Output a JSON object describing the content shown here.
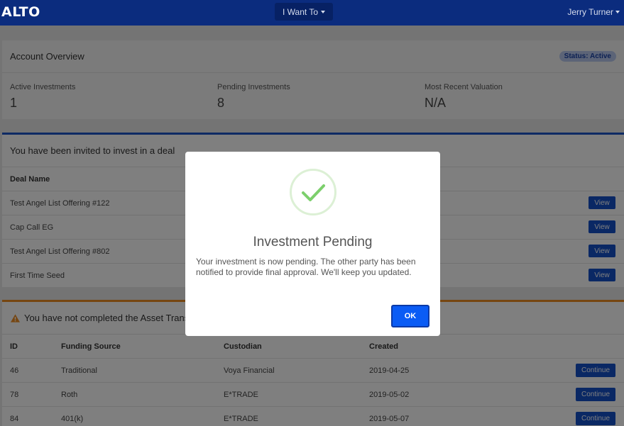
{
  "nav": {
    "logo": "ALTO",
    "menu_label": "I Want To",
    "user_name": "Jerry Turner"
  },
  "overview": {
    "title": "Account Overview",
    "status": "Status: Active",
    "stats": [
      {
        "label": "Active Investments",
        "value": "1"
      },
      {
        "label": "Pending Investments",
        "value": "8"
      },
      {
        "label": "Most Recent Valuation",
        "value": "N/A"
      }
    ]
  },
  "deals": {
    "title": "You have been invited to invest in a deal",
    "column": "Deal Name",
    "button_label": "View",
    "rows": [
      "Test Angel List Offering #122",
      "Cap Call EG",
      "Test Angel List Offering #802",
      "First Time Seed"
    ]
  },
  "transfers": {
    "title": "You have not completed the Asset Trans",
    "columns": [
      "ID",
      "Funding Source",
      "Custodian",
      "Created"
    ],
    "button_label": "Continue",
    "rows": [
      {
        "id": "46",
        "source": "Traditional",
        "custodian": "Voya Financial",
        "created": "2019-04-25"
      },
      {
        "id": "78",
        "source": "Roth",
        "custodian": "E*TRADE",
        "created": "2019-05-02"
      },
      {
        "id": "84",
        "source": "401(k)",
        "custodian": "E*TRADE",
        "created": "2019-05-07"
      }
    ]
  },
  "modal": {
    "title": "Investment Pending",
    "message": "Your investment is now pending. The other party has been notified to provide final approval. We'll keep you updated.",
    "ok_label": "OK"
  },
  "colors": {
    "nav": "#0b2c7e",
    "primary": "#1551c9",
    "warning": "#ec8c23",
    "success": "#7ccf6c"
  }
}
